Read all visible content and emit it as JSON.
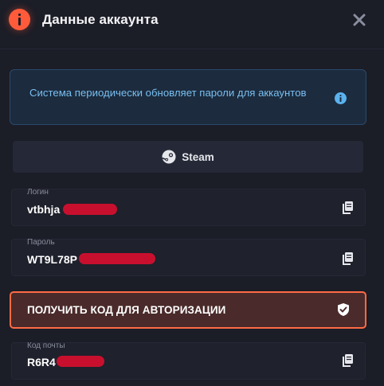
{
  "header": {
    "title": "Данные аккаунта",
    "alert_icon": "info-alert-icon",
    "close_icon": "close-icon"
  },
  "notice": {
    "text": "Система периодически обновляет пароли для аккаунтов",
    "icon": "info-icon"
  },
  "platform": {
    "label": "Steam",
    "icon": "steam-icon"
  },
  "fields": {
    "login": {
      "label": "Логин",
      "value": "vtbhja"
    },
    "password": {
      "label": "Пароль",
      "value": "WT9L78P"
    },
    "email_code": {
      "label": "Код почты",
      "value": "R6R4"
    }
  },
  "auth_button": {
    "label": "ПОЛУЧИТЬ КОД ДЛЯ АВТОРИЗАЦИИ",
    "icon": "shield-check-icon"
  },
  "colors": {
    "background": "#1b1d27",
    "accent": "#ff5b3a",
    "info_text": "#79bff0",
    "redaction": "#c8102e"
  }
}
